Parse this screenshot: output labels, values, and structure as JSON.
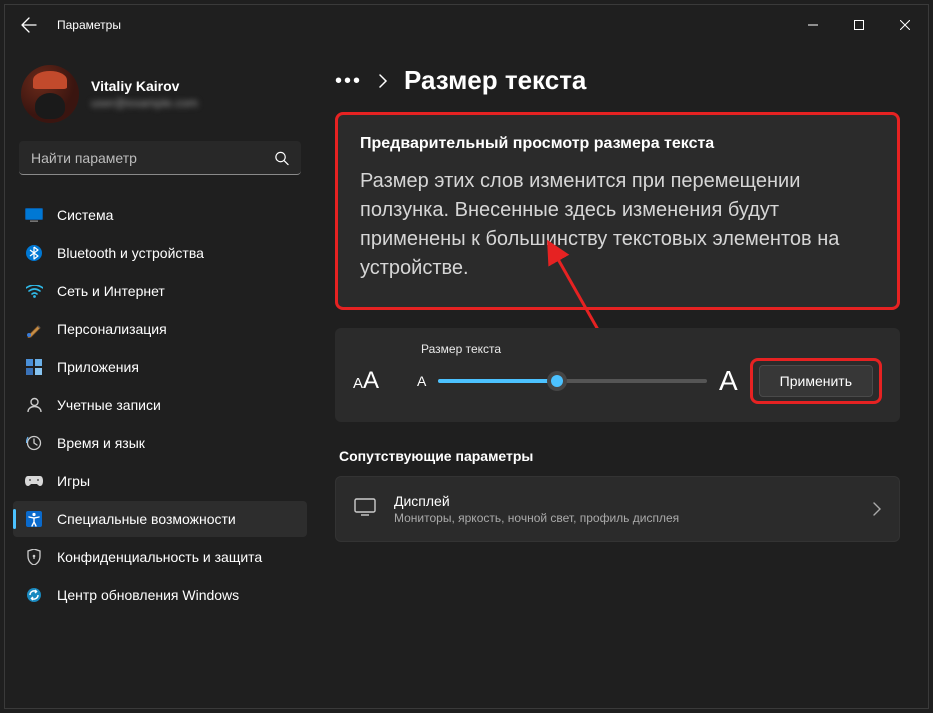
{
  "titlebar": {
    "app_title": "Параметры"
  },
  "profile": {
    "name": "Vitaliy Kairov",
    "email": "user@example.com"
  },
  "search": {
    "placeholder": "Найти параметр"
  },
  "sidebar": {
    "items": [
      {
        "label": "Система"
      },
      {
        "label": "Bluetooth и устройства"
      },
      {
        "label": "Сеть и Интернет"
      },
      {
        "label": "Персонализация"
      },
      {
        "label": "Приложения"
      },
      {
        "label": "Учетные записи"
      },
      {
        "label": "Время и язык"
      },
      {
        "label": "Игры"
      },
      {
        "label": "Специальные возможности"
      },
      {
        "label": "Конфиденциальность и защита"
      },
      {
        "label": "Центр обновления Windows"
      }
    ]
  },
  "breadcrumb": {
    "title": "Размер текста"
  },
  "preview": {
    "title": "Предварительный просмотр размера текста",
    "body": "Размер этих слов изменится при перемещении ползунка. Внесенные здесь изменения будут применены к большинству текстовых элементов на устройстве."
  },
  "slider": {
    "label": "Размер текста",
    "apply": "Применить"
  },
  "related": {
    "section": "Сопутствующие параметры",
    "title": "Дисплей",
    "sub": "Мониторы, яркость, ночной свет, профиль дисплея"
  },
  "colors": {
    "accent": "#4cc2ff",
    "highlight": "#e62222"
  }
}
